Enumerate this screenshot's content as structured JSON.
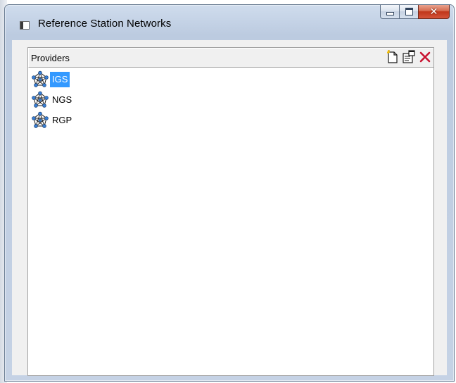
{
  "window": {
    "title": "Reference Station Networks",
    "buttons": {
      "minimize": "minimize",
      "maximize": "maximize",
      "close": "✕"
    }
  },
  "panel": {
    "title": "Providers",
    "toolbar": {
      "new_icon": "new-document-icon",
      "properties_icon": "properties-icon",
      "delete_icon": "delete-icon"
    }
  },
  "providers": [
    {
      "label": "IGS",
      "selected": true,
      "icon": "network-icon"
    },
    {
      "label": "NGS",
      "selected": false,
      "icon": "network-icon"
    },
    {
      "label": "RGP",
      "selected": false,
      "icon": "network-icon"
    }
  ],
  "colors": {
    "selection": "#3399ff",
    "close_button": "#c0361a",
    "delete_x": "#c8102e"
  }
}
